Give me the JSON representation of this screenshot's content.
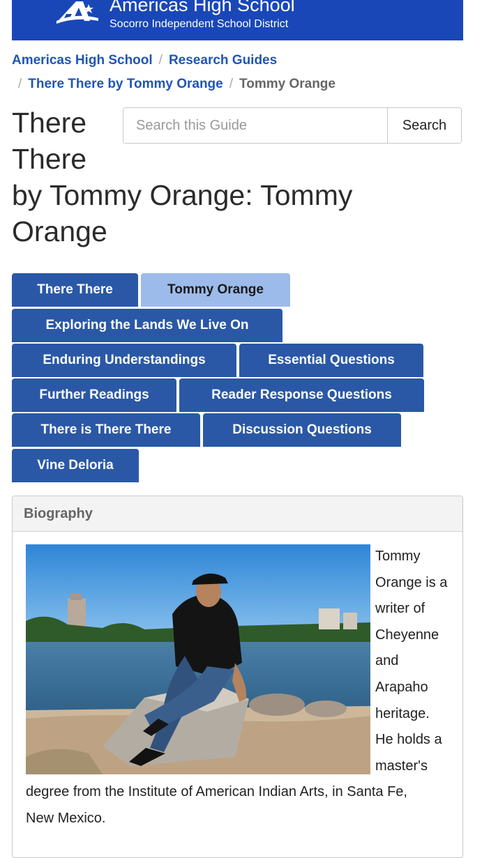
{
  "header": {
    "school_name": "Americas High School",
    "district_name": "Socorro Independent School District",
    "brand_color": "#1a47b8"
  },
  "breadcrumb": {
    "items": [
      "Americas High School",
      "Research Guides",
      "There There by Tommy Orange"
    ],
    "current": "Tommy Orange",
    "separator": "/"
  },
  "page": {
    "title_line1": "There There",
    "title_line2": "by Tommy Orange: Tommy Orange"
  },
  "search": {
    "placeholder": "Search this Guide",
    "button_label": "Search"
  },
  "tabs": [
    {
      "label": "There There",
      "active": false
    },
    {
      "label": "Tommy Orange",
      "active": true
    },
    {
      "label": "Exploring the Lands We Live On",
      "active": false
    },
    {
      "label": "Enduring Understandings",
      "active": false
    },
    {
      "label": "Essential Questions",
      "active": false
    },
    {
      "label": "Further Readings",
      "active": false
    },
    {
      "label": "Reader Response Questions",
      "active": false
    },
    {
      "label": "There is There There",
      "active": false
    },
    {
      "label": "Discussion Questions",
      "active": false
    },
    {
      "label": "Vine Deloria",
      "active": false
    }
  ],
  "biography": {
    "heading": "Biography",
    "lines_right": [
      "Tommy",
      "Orange is a",
      "writer of",
      "Cheyenne",
      "and",
      "Arapaho",
      "heritage.",
      "He holds a",
      "master's"
    ],
    "lines_bottom": [
      "degree from the Institute of American Indian Arts, in Santa Fe,",
      "New Mexico."
    ]
  }
}
